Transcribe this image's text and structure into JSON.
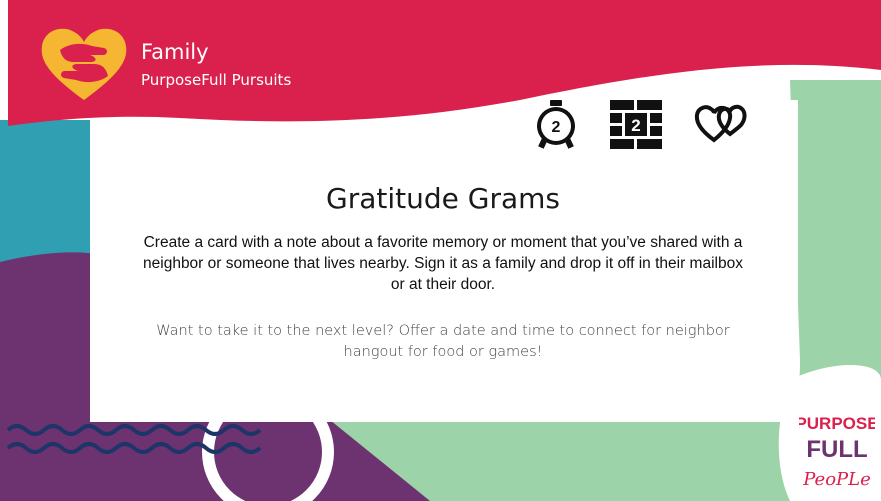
{
  "brand": {
    "title": "Family",
    "subtitle": "PurposeFull Pursuits"
  },
  "indicators": {
    "time_value": "2",
    "difficulty_value": "2",
    "icons": [
      "stopwatch-icon",
      "brick-wall-icon",
      "hearts-icon"
    ]
  },
  "card": {
    "title": "Gratitude Grams",
    "body": "Create a card with a note about a favorite memory or moment that you’ve shared with a neighbor or someone that lives nearby. Sign it as a family and drop it off in their mailbox or at their door.",
    "extra": "Want to take it to the next level? Offer a date and time to connect for neighbor hangout for food or games!"
  },
  "logo": {
    "line1": "PURPOSE",
    "line2": "FULL",
    "line3": "PeoPLe"
  },
  "colors": {
    "header_red": "#da214d",
    "teal": "#2f9fb1",
    "purple": "#6d3370",
    "mint": "#9dd3a8",
    "navy": "#1d3568",
    "heart_yellow": "#f5b731"
  }
}
